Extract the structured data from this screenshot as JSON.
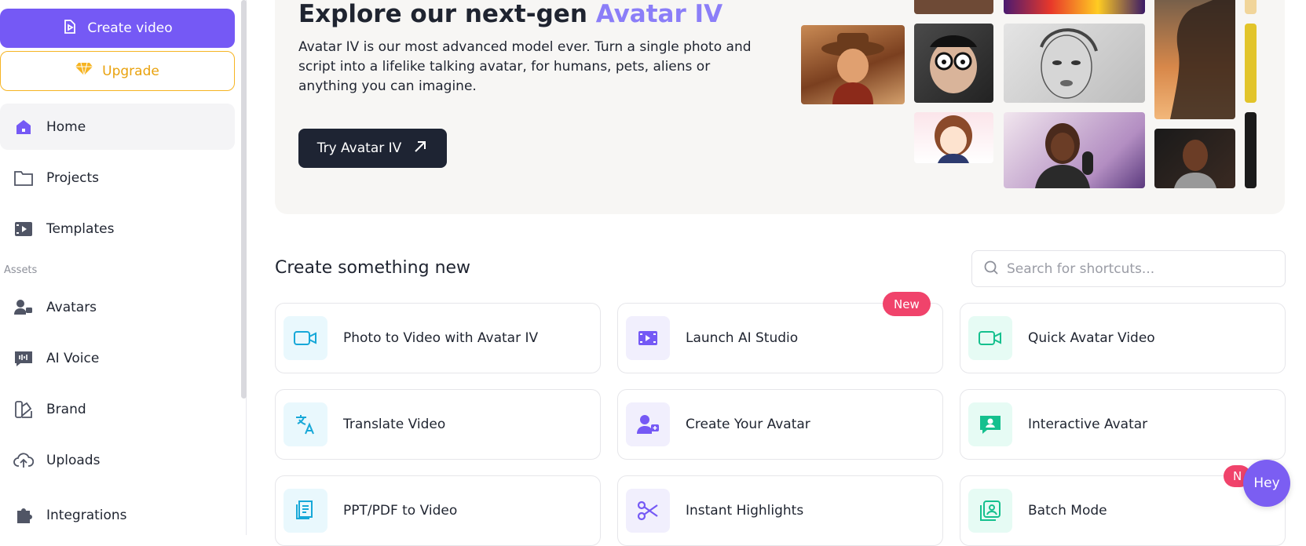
{
  "sidebar": {
    "create_video": "Create video",
    "upgrade": "Upgrade",
    "assets_label": "Assets",
    "items": [
      {
        "label": "Home"
      },
      {
        "label": "Projects"
      },
      {
        "label": "Templates"
      },
      {
        "label": "Avatars"
      },
      {
        "label": "AI Voice"
      },
      {
        "label": "Brand"
      },
      {
        "label": "Uploads"
      },
      {
        "label": "Integrations"
      }
    ]
  },
  "banner": {
    "title_main": "Explore our next-gen ",
    "title_accent": "Avatar IV",
    "description": "Avatar IV is our most advanced model ever. Turn a single photo and script into a lifelike talking avatar, for humans, pets, aliens or anything you can imagine.",
    "button": "Try Avatar IV"
  },
  "shortcuts": {
    "title": "Create something new",
    "search_placeholder": "Search for shortcuts...",
    "badge_new": "New",
    "badge_new_partial": "N",
    "cards": [
      {
        "label": "Photo to Video with Avatar IV",
        "icon": "video-camera-icon"
      },
      {
        "label": "Launch AI Studio",
        "icon": "film-icon"
      },
      {
        "label": "Quick Avatar Video",
        "icon": "video-camera-icon"
      },
      {
        "label": "Translate Video",
        "icon": "translate-icon"
      },
      {
        "label": "Create Your Avatar",
        "icon": "user-add-icon"
      },
      {
        "label": "Interactive Avatar",
        "icon": "chat-avatar-icon"
      },
      {
        "label": "PPT/PDF to Video",
        "icon": "document-icon"
      },
      {
        "label": "Instant Highlights",
        "icon": "scissors-icon"
      },
      {
        "label": "Batch Mode",
        "icon": "batch-icon"
      }
    ]
  },
  "chat": {
    "label": "Hey"
  },
  "colors": {
    "primary": "#7559f5",
    "upgrade": "#f6b422",
    "dark_button": "#1e2433",
    "badge": "#f0436b",
    "accent_text": "#8b7ef8"
  }
}
